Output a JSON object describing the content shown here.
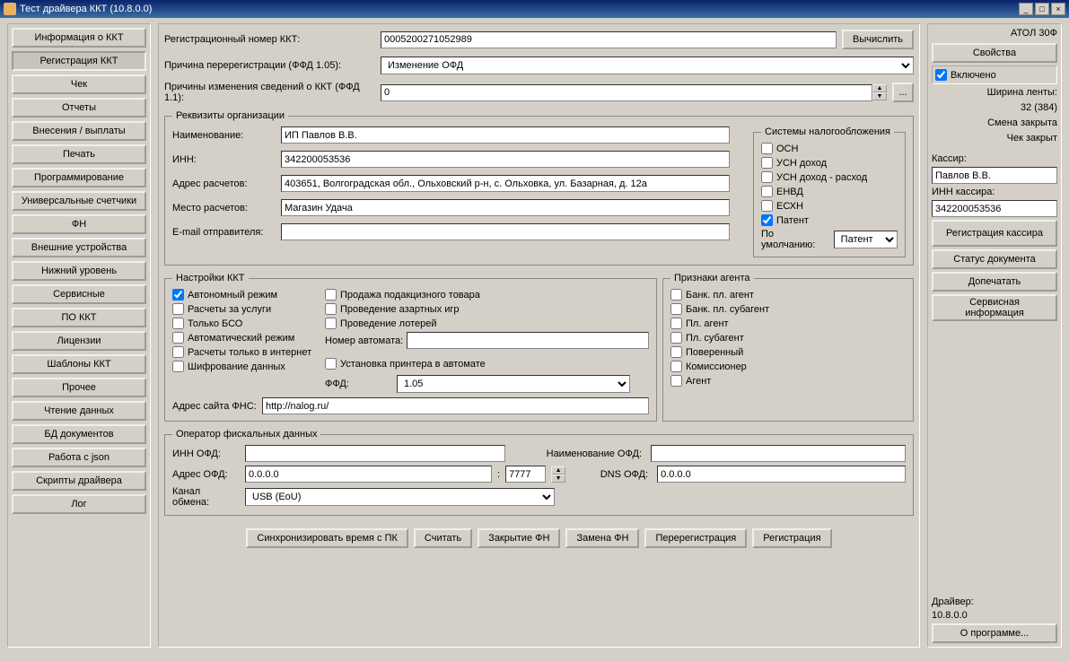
{
  "window": {
    "title": "Тест драйвера ККТ (10.8.0.0)"
  },
  "nav": [
    "Информация о ККТ",
    "Регистрация ККТ",
    "Чек",
    "Отчеты",
    "Внесения / выплаты",
    "Печать",
    "Программирование",
    "Универсальные счетчики",
    "ФН",
    "Внешние устройства",
    "Нижний уровень",
    "Сервисные",
    "ПО ККТ",
    "Лицензии",
    "Шаблоны ККТ",
    "Прочее",
    "Чтение данных",
    "БД документов",
    "Работа с json",
    "Скрипты драйвера",
    "Лог"
  ],
  "navActive": 1,
  "top": {
    "regnum_lbl": "Регистрационный номер ККТ:",
    "regnum": "0005200271052989",
    "calc": "Вычислить",
    "reason105_lbl": "Причина перерегистрации (ФФД 1.05):",
    "reason105": "Изменение ОФД",
    "reason11_lbl": "Причины изменения сведений о ККТ (ФФД 1.1):",
    "reason11": "0",
    "dots": "..."
  },
  "org": {
    "legend": "Реквизиты организации",
    "name_lbl": "Наименование:",
    "name": "ИП Павлов В.В.",
    "inn_lbl": "ИНН:",
    "inn": "342200053536",
    "addr_lbl": "Адрес расчетов:",
    "addr": "403651, Волгоградская обл., Ольховский р-н, с. Ольховка, ул. Базарная, д. 12а",
    "place_lbl": "Место расчетов:",
    "place": "Магазин Удача",
    "email_lbl": "E-mail отправителя:",
    "email": ""
  },
  "tax": {
    "legend": "Системы налогообложения",
    "items": [
      {
        "label": "ОСН",
        "checked": false
      },
      {
        "label": "УСН доход",
        "checked": false
      },
      {
        "label": "УСН доход - расход",
        "checked": false
      },
      {
        "label": "ЕНВД",
        "checked": false
      },
      {
        "label": "ЕСХН",
        "checked": false
      },
      {
        "label": "Патент",
        "checked": true
      }
    ],
    "default_lbl": "По умолчанию:",
    "default": "Патент"
  },
  "settings": {
    "legend": "Настройки ККТ",
    "col1": [
      {
        "label": "Автономный режим",
        "checked": true
      },
      {
        "label": "Расчеты за услуги",
        "checked": false
      },
      {
        "label": "Только БСО",
        "checked": false
      },
      {
        "label": "Автоматический режим",
        "checked": false
      },
      {
        "label": "Расчеты только в интернет",
        "checked": false
      },
      {
        "label": "Шифрование данных",
        "checked": false
      }
    ],
    "col2": [
      {
        "label": "Продажа подакцизного товара",
        "checked": false
      },
      {
        "label": "Проведение азартных игр",
        "checked": false
      },
      {
        "label": "Проведение лотерей",
        "checked": false
      }
    ],
    "automat_lbl": "Номер автомата:",
    "automat": "",
    "printer_lbl": "Установка принтера в автомате",
    "printer": false,
    "ffd_lbl": "ФФД:",
    "ffd": "1.05",
    "fns_lbl": "Адрес сайта ФНС:",
    "fns": "http://nalog.ru/"
  },
  "agent": {
    "legend": "Признаки агента",
    "items": [
      {
        "label": "Банк. пл. агент",
        "checked": false
      },
      {
        "label": "Банк. пл. субагент",
        "checked": false
      },
      {
        "label": "Пл. агент",
        "checked": false
      },
      {
        "label": "Пл. субагент",
        "checked": false
      },
      {
        "label": "Поверенный",
        "checked": false
      },
      {
        "label": "Комиссионер",
        "checked": false
      },
      {
        "label": "Агент",
        "checked": false
      }
    ]
  },
  "ofd": {
    "legend": "Оператор фискальных данных",
    "inn_lbl": "ИНН ОФД:",
    "inn": "",
    "name_lbl": "Наименование ОФД:",
    "name": "",
    "addr_lbl": "Адрес ОФД:",
    "addr": "0.0.0.0",
    "port": "7777",
    "dns_lbl": "DNS ОФД:",
    "dns": "0.0.0.0",
    "channel_lbl": "Канал обмена:",
    "channel": "USB (EoU)"
  },
  "bottom": [
    "Синхронизировать время с ПК",
    "Считать",
    "Закрытие ФН",
    "Замена ФН",
    "Перерегистрация",
    "Регистрация"
  ],
  "right": {
    "model": "АТОЛ 30Ф",
    "props": "Свойства",
    "enabled": "Включено",
    "enabled_checked": true,
    "tape": "Ширина ленты:",
    "tape_val": "32 (384)",
    "shift": "Смена закрыта",
    "cheque": "Чек закрыт",
    "cashier_lbl": "Кассир:",
    "cashier": "Павлов В.В.",
    "cashier_inn_lbl": "ИНН кассира:",
    "cashier_inn": "342200053536",
    "reg_cashier": "Регистрация кассира",
    "doc_status": "Статус документа",
    "reprint": "Допечатать",
    "service": "Сервисная информация",
    "driver_lbl": "Драйвер:",
    "driver": "10.8.0.0",
    "about": "О программе..."
  }
}
